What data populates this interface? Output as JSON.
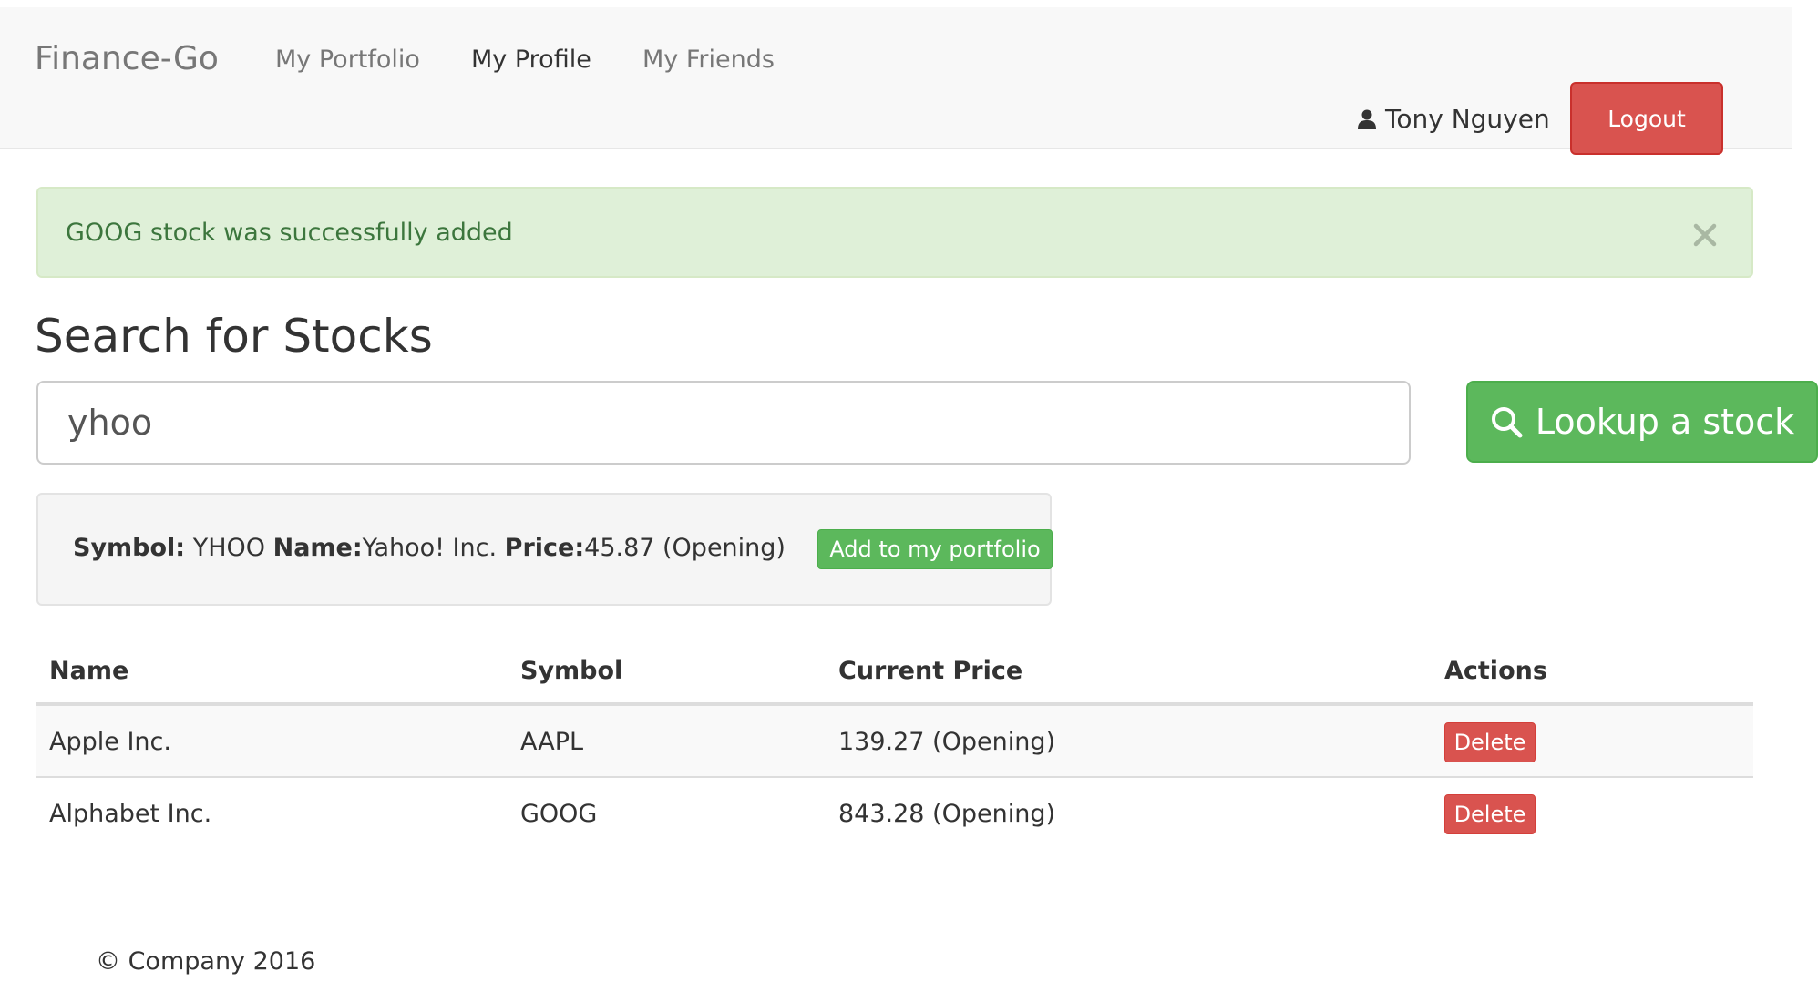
{
  "navbar": {
    "brand": "Finance-Go",
    "links": [
      {
        "label": "My Portfolio",
        "active": false
      },
      {
        "label": "My Profile",
        "active": true
      },
      {
        "label": "My Friends",
        "active": false
      }
    ],
    "user_name": "Tony Nguyen",
    "logout_label": "Logout"
  },
  "alert": {
    "message": "GOOG stock was successfully added",
    "close_icon": "close-icon"
  },
  "search": {
    "heading": "Search for Stocks",
    "value": "yhoo",
    "button_label": "Lookup a stock"
  },
  "result": {
    "symbol_label": "Symbol:",
    "symbol": "YHOO",
    "name_label": "Name:",
    "name": "Yahoo! Inc.",
    "price_label": "Price:",
    "price": "45.87 (Opening)",
    "add_label": "Add to my portfolio"
  },
  "table": {
    "headers": [
      "Name",
      "Symbol",
      "Current Price",
      "Actions"
    ],
    "rows": [
      {
        "name": "Apple Inc.",
        "symbol": "AAPL",
        "price": "139.27 (Opening)",
        "action": "Delete"
      },
      {
        "name": "Alphabet Inc.",
        "symbol": "GOOG",
        "price": "843.28 (Opening)",
        "action": "Delete"
      }
    ]
  },
  "footer": {
    "text": "© Company 2016"
  },
  "colors": {
    "success": "#5cb85c",
    "danger": "#d9534f",
    "alert_bg": "#dff0d8",
    "alert_text": "#3c763d"
  }
}
